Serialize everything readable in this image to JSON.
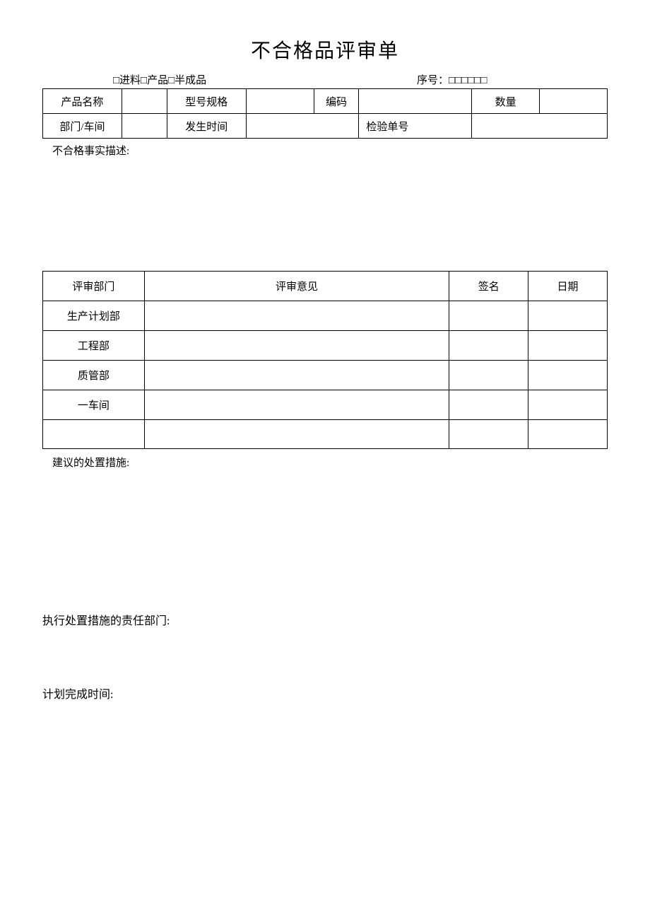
{
  "title": "不合格品评审单",
  "meta": {
    "checkboxes": "□进料□产品□半成品",
    "serial_label": "序号：",
    "serial_boxes": "□□□□□□"
  },
  "info": {
    "row1": {
      "c1": "产品名称",
      "c2": "",
      "c3": "型号规格",
      "c4": "",
      "c5": "编码",
      "c6": "",
      "c7": "数量",
      "c8": ""
    },
    "row2": {
      "c1": "部门/车间",
      "c2": "",
      "c3": "发生时间",
      "c4": "",
      "c5": "检验单号",
      "c6": ""
    }
  },
  "desc_label": "不合格事实描述:",
  "review": {
    "headers": {
      "dept": "评审部门",
      "opinion": "评审意见",
      "sign": "签名",
      "date": "日期"
    },
    "rows": [
      {
        "dept": "生产计划部",
        "opinion": "",
        "sign": "",
        "date": ""
      },
      {
        "dept": "工程部",
        "opinion": "",
        "sign": "",
        "date": ""
      },
      {
        "dept": "质管部",
        "opinion": "",
        "sign": "",
        "date": ""
      },
      {
        "dept": "一车间",
        "opinion": "",
        "sign": "",
        "date": ""
      },
      {
        "dept": "",
        "opinion": "",
        "sign": "",
        "date": ""
      }
    ]
  },
  "suggest_label": "建议的处置措施:",
  "responsible_label": "执行处置措施的责任部门:",
  "plan_label": "计划完成时间:"
}
